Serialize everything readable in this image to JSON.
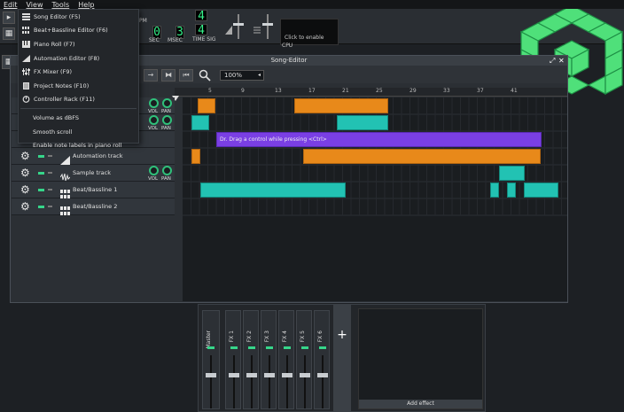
{
  "menubar": {
    "items": [
      "Edit",
      "View",
      "Tools",
      "Help"
    ]
  },
  "toolbar": {
    "bpm_label": "PM",
    "time_sig_label": "TIME SIG",
    "time_sig_top": "4",
    "time_sig_bottom": "4",
    "sec_value": "0",
    "msec_value": "3",
    "sec_label": "SEC",
    "msec_label": "MSEC",
    "cpu_hint": "Click to enable",
    "cpu_label": "CPU"
  },
  "view_menu": {
    "items": [
      {
        "label": "Song Editor (F5)",
        "icon": "song-editor-icon"
      },
      {
        "label": "Beat+Bassline Editor (F6)",
        "icon": "beat-bassline-icon"
      },
      {
        "label": "Piano Roll (F7)",
        "icon": "piano-roll-icon"
      },
      {
        "label": "Automation Editor (F8)",
        "icon": "automation-icon"
      },
      {
        "label": "FX Mixer (F9)",
        "icon": "fx-mixer-icon"
      },
      {
        "label": "Project Notes (F10)",
        "icon": "project-notes-icon"
      },
      {
        "label": "Controller Rack (F11)",
        "icon": "controller-rack-icon"
      }
    ],
    "options": [
      "Volume as dBFS",
      "Smooth scroll",
      "Enable note labels in piano roll"
    ]
  },
  "song_editor": {
    "title": "Song-Editor",
    "zoom": "100%",
    "ruler_ticks": [
      "5",
      "9",
      "13",
      "17",
      "21",
      "25",
      "29",
      "33",
      "37",
      "41"
    ],
    "tracks": [
      {
        "name": "",
        "type": "instrument",
        "show_knobs": true
      },
      {
        "name": "",
        "type": "instrument",
        "show_knobs": true
      },
      {
        "name": "",
        "type": "instrument",
        "show_knobs": false
      },
      {
        "name": "Automation track",
        "type": "automation",
        "show_knobs": false
      },
      {
        "name": "Sample track",
        "type": "sample",
        "show_knobs": true
      },
      {
        "name": "Beat/Bassline 1",
        "type": "bb",
        "show_knobs": false
      },
      {
        "name": "Beat/Bassline 2",
        "type": "bb",
        "show_knobs": false
      }
    ],
    "knob_labels": {
      "vol": "VOL",
      "pan": "PAN"
    },
    "automation_clip_label": "Dr. Drag a control while pressing <Ctrl>"
  },
  "fx_mixer": {
    "channels": [
      "Master",
      "FX 1",
      "FX 2",
      "FX 3",
      "FX 4",
      "FX 5",
      "FX 6"
    ],
    "add_effect_label": "Add effect",
    "add_channel_label": "+"
  },
  "colors": {
    "accent_green": "#36d68a",
    "clip_orange": "#e8891a",
    "clip_teal": "#22c2b3",
    "clip_purple": "#7a3fe4"
  }
}
